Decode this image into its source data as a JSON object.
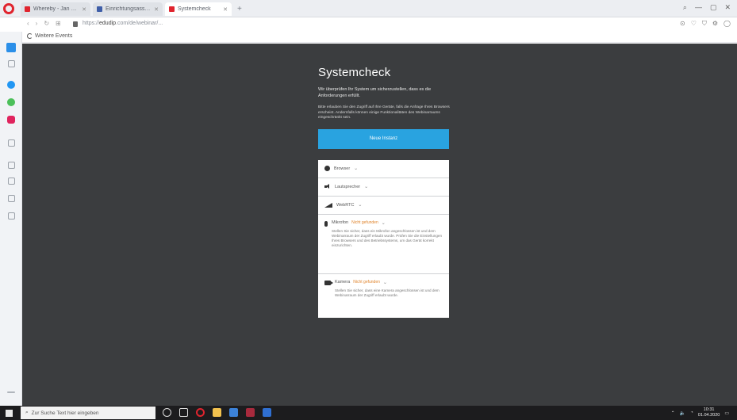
{
  "browser": {
    "tabs": [
      {
        "title": "Whereby - Jan 2020 Kev...",
        "active": false
      },
      {
        "title": "Einrichtungsassistent ...",
        "active": false
      },
      {
        "title": "Systemcheck",
        "active": true
      }
    ],
    "new_tab": "+",
    "url_prefix": "https://",
    "url_domain": "edudip",
    "url_rest": ".com/de/webinar/...",
    "bookmark": "Weitere Events"
  },
  "page": {
    "title": "Systemcheck",
    "intro": "Wir überprüfen Ihr System um sicherzustellen, dass es die Anforderungen erfüllt.",
    "note": "Bitte erlauben Sie den Zugriff auf Ihre Geräte, falls die Anfrage Ihres Browsers erscheint. Andernfalls können einige Funktionalitäten des Webinarraums eingeschränkt sein.",
    "start_button": "Neue Instanz",
    "checks": {
      "browser": {
        "label": "Browser",
        "icon": "globe-icon"
      },
      "speaker": {
        "label": "Lautsprecher",
        "icon": "speaker-icon"
      },
      "network": {
        "label": "WebRTC",
        "icon": "signal-icon"
      },
      "microphone": {
        "label": "Mikrofon",
        "status": "Nicht gefunden",
        "description": "Stellen Sie sicher, dass ein Mikrofon angeschlossen ist und dem Webinarraum der Zugriff erlaubt wurde. Prüfen Sie die Einstellungen Ihres Browsers und des Betriebssystems, um das Gerät korrekt einzurichten."
      },
      "camera": {
        "label": "Kamera",
        "status": "Nicht gefunden",
        "description": "Stellen Sie sicher, dass eine Kamera angeschlossen ist und dem Webinarraum der Zugriff erlaubt wurde."
      }
    }
  },
  "taskbar": {
    "search_placeholder": "Zur Suche Text hier eingeben",
    "time": "10:31",
    "date": "01.04.2020"
  },
  "colors": {
    "page_bg": "#3b3d3f",
    "primary": "#29a3e0",
    "warning": "#e0852e"
  }
}
